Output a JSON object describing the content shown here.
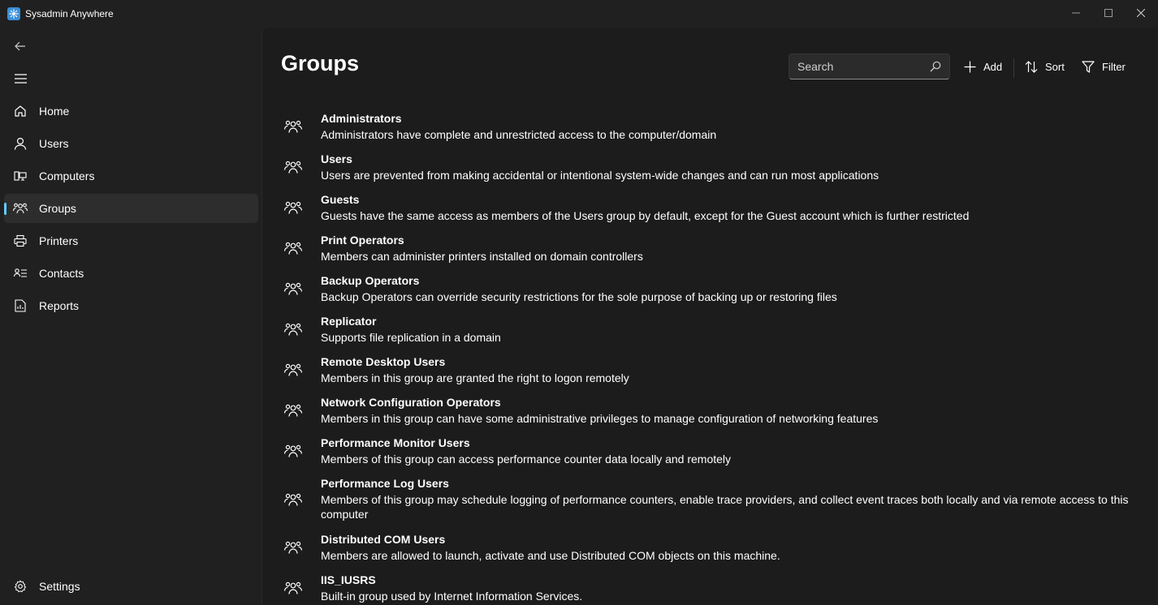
{
  "app": {
    "title": "Sysadmin Anywhere"
  },
  "nav": {
    "items": [
      {
        "label": "Home",
        "icon": "home-icon"
      },
      {
        "label": "Users",
        "icon": "user-icon"
      },
      {
        "label": "Computers",
        "icon": "computer-icon"
      },
      {
        "label": "Groups",
        "icon": "people-icon",
        "selected": true
      },
      {
        "label": "Printers",
        "icon": "printer-icon"
      },
      {
        "label": "Contacts",
        "icon": "contact-card-icon"
      },
      {
        "label": "Reports",
        "icon": "report-icon"
      }
    ],
    "settings_label": "Settings"
  },
  "page": {
    "title": "Groups"
  },
  "toolbar": {
    "search_placeholder": "Search",
    "add_label": "Add",
    "sort_label": "Sort",
    "filter_label": "Filter"
  },
  "groups": [
    {
      "name": "Administrators",
      "description": "Administrators have complete and unrestricted access to the computer/domain"
    },
    {
      "name": "Users",
      "description": "Users are prevented from making accidental or intentional system-wide changes and can run most applications"
    },
    {
      "name": "Guests",
      "description": "Guests have the same access as members of the Users group by default, except for the Guest account which is further restricted"
    },
    {
      "name": "Print Operators",
      "description": "Members can administer printers installed on domain controllers"
    },
    {
      "name": "Backup Operators",
      "description": "Backup Operators can override security restrictions for the sole purpose of backing up or restoring files"
    },
    {
      "name": "Replicator",
      "description": "Supports file replication in a domain"
    },
    {
      "name": "Remote Desktop Users",
      "description": "Members in this group are granted the right to logon remotely"
    },
    {
      "name": "Network Configuration Operators",
      "description": "Members in this group can have some administrative privileges to manage configuration of networking features"
    },
    {
      "name": "Performance Monitor Users",
      "description": "Members of this group can access performance counter data locally and remotely"
    },
    {
      "name": "Performance Log Users",
      "description": "Members of this group may schedule logging of performance counters, enable trace providers, and collect event traces both locally and via remote access to this computer"
    },
    {
      "name": "Distributed COM Users",
      "description": "Members are allowed to launch, activate and use Distributed COM objects on this machine."
    },
    {
      "name": "IIS_IUSRS",
      "description": "Built-in group used by Internet Information Services."
    }
  ],
  "colors": {
    "accent": "#60cdff",
    "background": "#202020",
    "content": "#1c1c1c"
  }
}
